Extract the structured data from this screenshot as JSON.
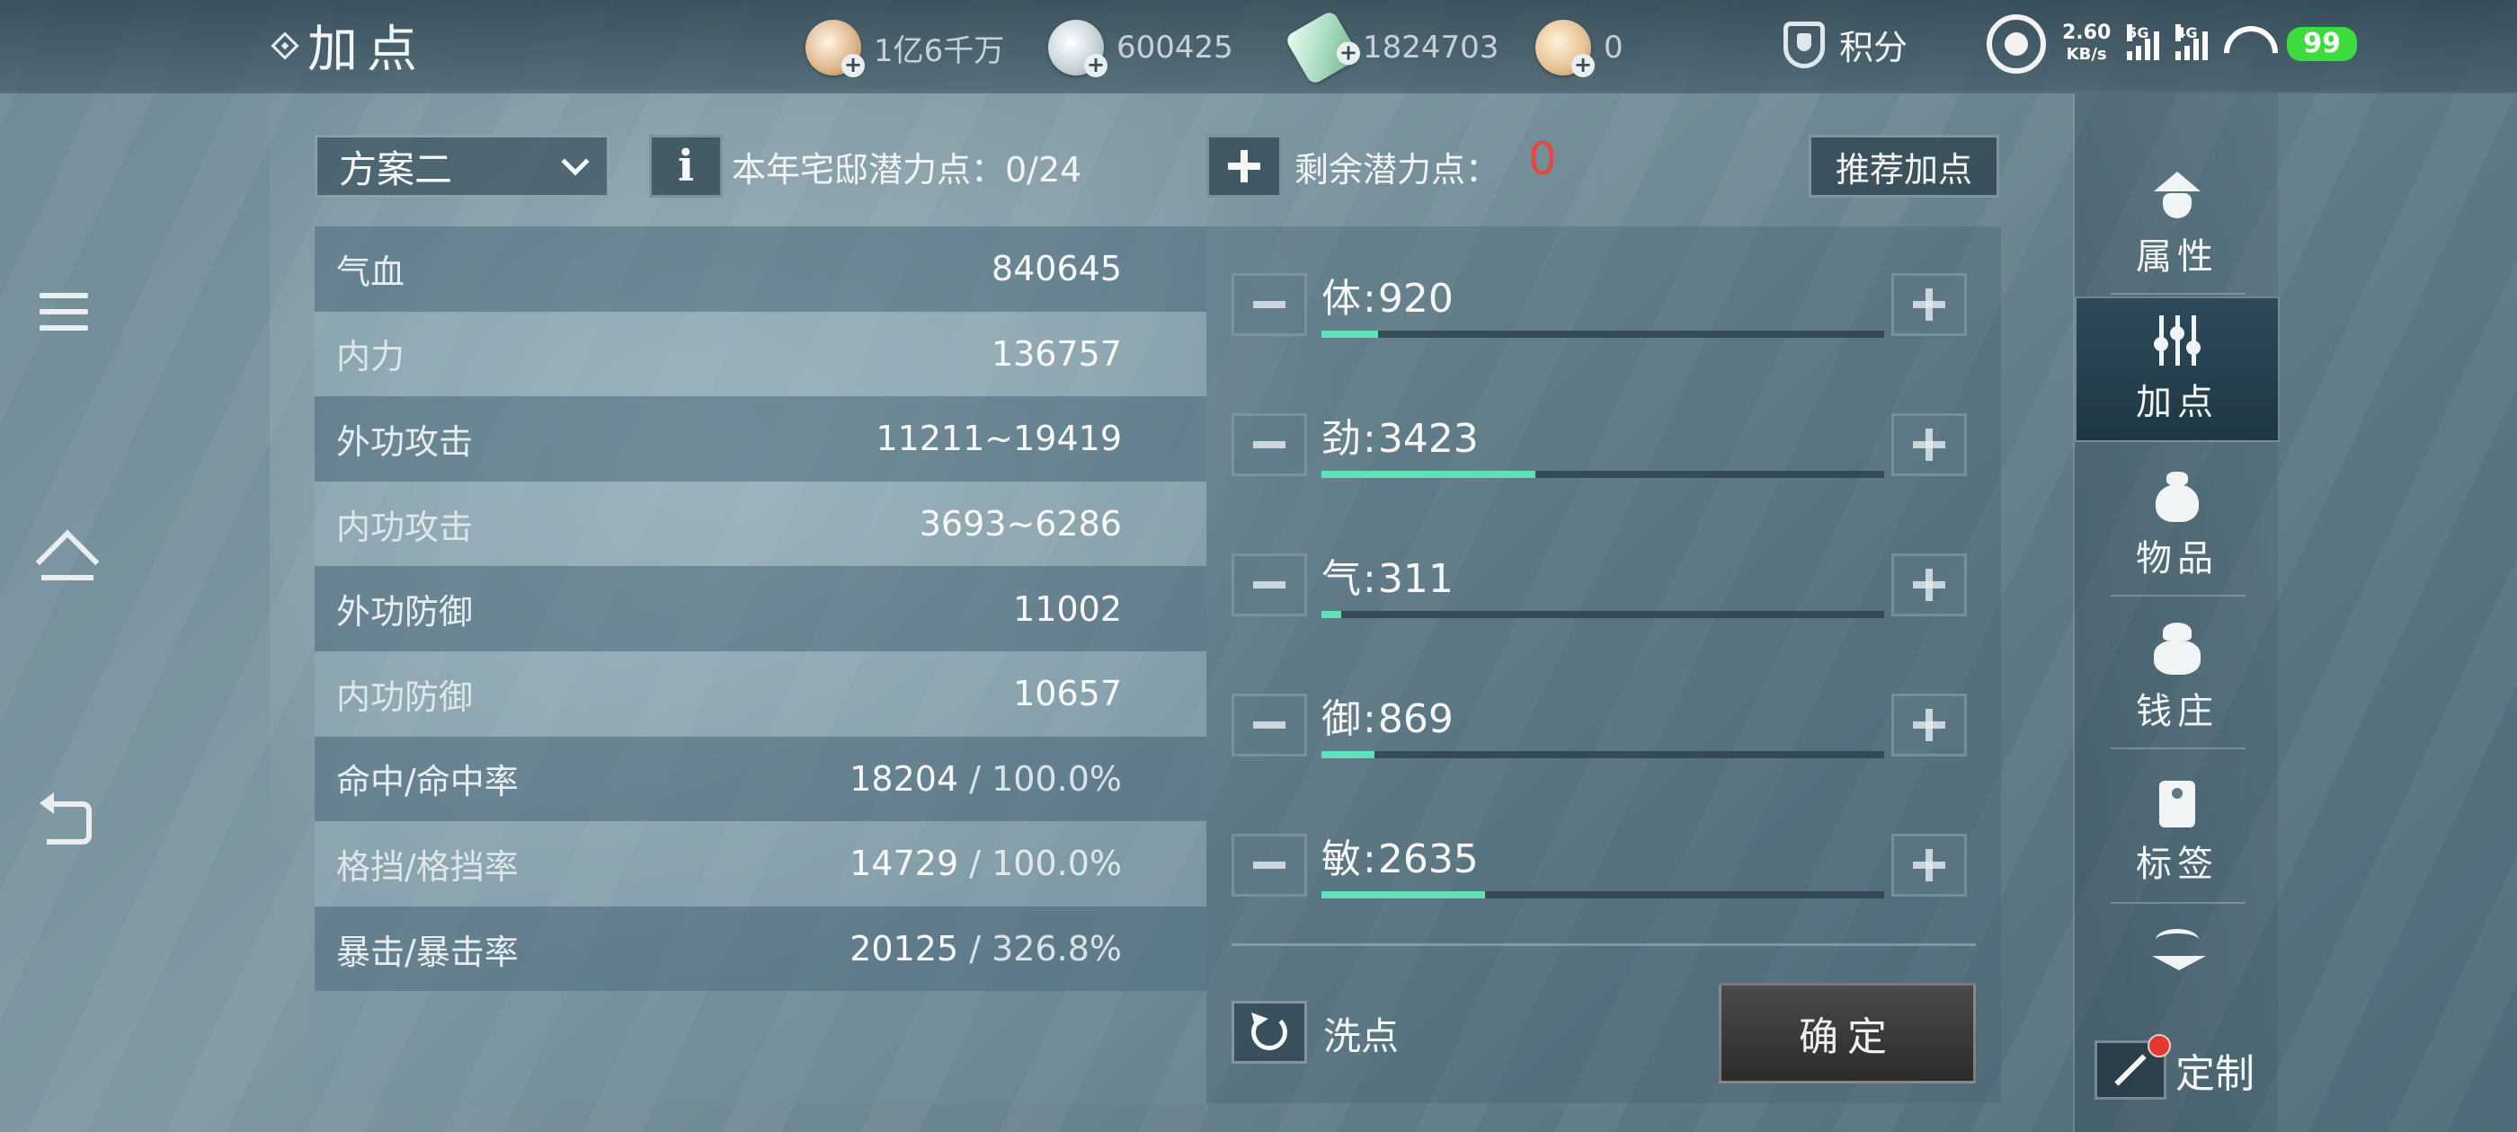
{
  "header": {
    "title": "加点",
    "currencies": [
      {
        "name": "copper-coin-icon",
        "value": "1亿6千万"
      },
      {
        "name": "silver-ingot-icon",
        "value": "600425"
      },
      {
        "name": "jade-ticket-icon",
        "value": "1824703"
      },
      {
        "name": "gold-ingot-icon",
        "value": "0"
      }
    ],
    "score_label": "积分"
  },
  "status_bar": {
    "speed": "2.60",
    "speed_unit": "KB/s",
    "network_1": "5G",
    "network_2": "4G",
    "battery": "99"
  },
  "controls": {
    "scheme": "方案二",
    "info_label": "i",
    "house_points": "本年宅邸潜力点：0/24",
    "remaining_label": "剩余潜力点：",
    "remaining_value": "0",
    "recommend": "推荐加点"
  },
  "stats": [
    {
      "label": "气血",
      "value": "840645"
    },
    {
      "label": "内力",
      "value": "136757"
    },
    {
      "label": "外功攻击",
      "value": "11211~19419"
    },
    {
      "label": "内功攻击",
      "value": "3693~6286"
    },
    {
      "label": "外功防御",
      "value": "11002"
    },
    {
      "label": "内功防御",
      "value": "10657"
    },
    {
      "label": "命中/命中率",
      "value": "18204",
      "pct": "100.0%"
    },
    {
      "label": "格挡/格挡率",
      "value": "14729",
      "pct": "100.0%"
    },
    {
      "label": "暴击/暴击率",
      "value": "20125",
      "pct": "326.8%"
    }
  ],
  "attributes": [
    {
      "label": "体",
      "value": "920",
      "fill": 0.1
    },
    {
      "label": "劲",
      "value": "3423",
      "fill": 0.38
    },
    {
      "label": "气",
      "value": "311",
      "fill": 0.035
    },
    {
      "label": "御",
      "value": "869",
      "fill": 0.095
    },
    {
      "label": "敏",
      "value": "2635",
      "fill": 0.29
    }
  ],
  "actions": {
    "wash": "洗点",
    "confirm": "确定"
  },
  "right_nav": {
    "tabs": [
      {
        "label": "属性",
        "icon": "hat-icon"
      },
      {
        "label": "加点",
        "icon": "sliders-icon"
      },
      {
        "label": "物品",
        "icon": "bag-icon"
      },
      {
        "label": "钱庄",
        "icon": "money-bag-icon"
      },
      {
        "label": "标签",
        "icon": "tag-icon"
      }
    ],
    "custom": "定制"
  },
  "colors": {
    "accent_fill": "#5fe0b6",
    "remaining_red": "#e8463e",
    "battery_green": "#3ddc3d"
  }
}
